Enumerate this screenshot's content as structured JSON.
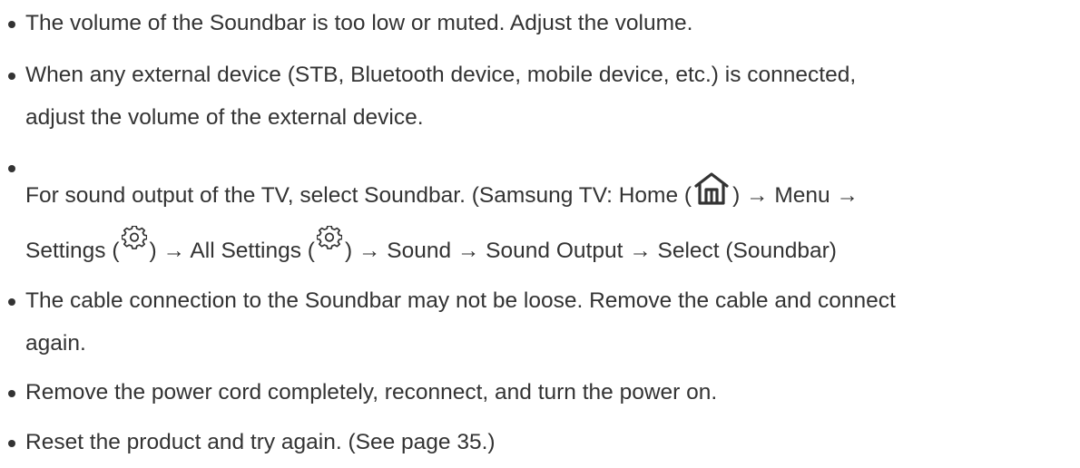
{
  "items": [
    {
      "lines": [
        "The volume of the Soundbar is too low or muted. Adjust the volume."
      ]
    },
    {
      "lines": [
        "When any external device (STB, Bluetooth device, mobile device, etc.) is connected,",
        "adjust the volume of the external device."
      ]
    },
    {
      "line1": {
        "before_home": "For sound output of the TV, select Soundbar. (Samsung TV: Home (",
        "after_home": ") → Menu →"
      },
      "line2": {
        "settings_prefix": "Settings (",
        "after_settings": ") → All Settings (",
        "after_all_settings": ") → Sound → Sound Output → Select (Soundbar)"
      },
      "icons": [
        "home-icon",
        "settings-icon",
        "settings-icon"
      ]
    },
    {
      "lines": [
        "The cable connection to the Soundbar may not be loose. Remove the cable and connect",
        "again."
      ]
    },
    {
      "lines": [
        "Remove the power cord completely, reconnect, and turn the power on."
      ]
    },
    {
      "lines": [
        "Reset the product and try again. (See page 35.)"
      ]
    }
  ]
}
